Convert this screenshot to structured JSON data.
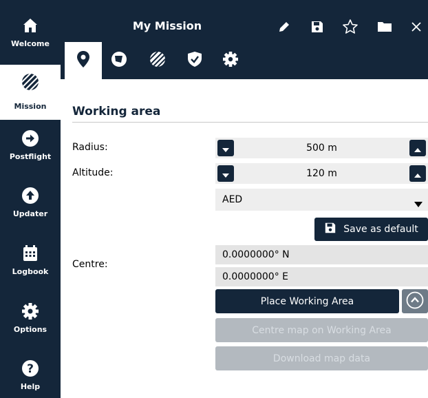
{
  "sidebar": {
    "items": [
      {
        "label": "Welcome",
        "icon": "home-icon"
      },
      {
        "label": "Mission",
        "icon": "mission-hatch-icon",
        "active": true
      },
      {
        "label": "Postflight",
        "icon": "arrow-right-circle-icon"
      },
      {
        "label": "Updater",
        "icon": "upload-circle-icon"
      },
      {
        "label": "Logbook",
        "icon": "calendar-icon"
      },
      {
        "label": "Options",
        "icon": "gear-icon"
      },
      {
        "label": "Help",
        "icon": "question-circle-icon"
      }
    ]
  },
  "header": {
    "title": "My Mission",
    "actions": [
      "pencil-icon",
      "save-icon",
      "star-outline-icon",
      "folder-icon",
      "close-icon"
    ]
  },
  "tabs": [
    {
      "icon": "map-pin-icon",
      "active": true
    },
    {
      "icon": "area-shape-icon"
    },
    {
      "icon": "hatch-pattern-icon"
    },
    {
      "icon": "shield-check-icon"
    },
    {
      "icon": "gear-icon"
    }
  ],
  "section": {
    "title": "Working area"
  },
  "form": {
    "radius_label": "Radius:",
    "radius_value": "500 m",
    "altitude_label": "Altitude:",
    "altitude_value": "120 m",
    "altitude_reference": "AED",
    "save_default_label": "Save as default",
    "centre_label": "Centre:",
    "centre_lat": "0.0000000° N",
    "centre_lon": "0.0000000° E",
    "place_label": "Place Working Area",
    "centre_map_label": "Centre map on Working Area",
    "download_label": "Download map data"
  },
  "colors": {
    "navy": "#14263a",
    "field_bg": "#eeeeee",
    "disabled_bg": "#b3b9bf"
  }
}
